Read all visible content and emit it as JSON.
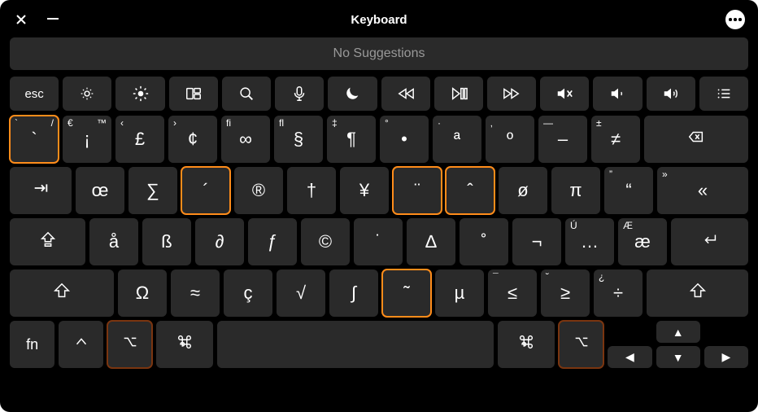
{
  "title": "Keyboard",
  "suggestions": "No Suggestions",
  "fnRow": [
    {
      "name": "esc",
      "label": "esc",
      "icon": null
    },
    {
      "name": "brightness-down",
      "icon": "bd"
    },
    {
      "name": "brightness-up",
      "icon": "bu"
    },
    {
      "name": "mission-control",
      "icon": "mc"
    },
    {
      "name": "spotlight",
      "icon": "search"
    },
    {
      "name": "dictation",
      "icon": "mic"
    },
    {
      "name": "do-not-disturb",
      "icon": "moon"
    },
    {
      "name": "rewind",
      "icon": "rw"
    },
    {
      "name": "play-pause",
      "icon": "pp"
    },
    {
      "name": "fast-forward",
      "icon": "ff"
    },
    {
      "name": "mute",
      "icon": "mute"
    },
    {
      "name": "volume-down",
      "icon": "vd"
    },
    {
      "name": "volume-up",
      "icon": "vu"
    },
    {
      "name": "list",
      "icon": "list"
    }
  ],
  "rows": [
    [
      {
        "name": "grave-key",
        "w": "w1",
        "main": "`",
        "tl": "`",
        "tr": "/",
        "cls": "orange"
      },
      {
        "name": "one-key",
        "w": "w1",
        "main": "¡",
        "tl": "€",
        "tr": "™"
      },
      {
        "name": "two-key",
        "w": "w1",
        "main": "£",
        "tl": "‹"
      },
      {
        "name": "three-key",
        "w": "w1",
        "main": "¢",
        "tl": "›"
      },
      {
        "name": "four-key",
        "w": "w1",
        "main": "∞",
        "tl": "fi"
      },
      {
        "name": "five-key",
        "w": "w1",
        "main": "§",
        "tl": "fl"
      },
      {
        "name": "six-key",
        "w": "w1",
        "main": "¶",
        "tl": "‡"
      },
      {
        "name": "seven-key",
        "w": "w1",
        "main": "•",
        "tl": "°"
      },
      {
        "name": "eight-key",
        "w": "w1",
        "main": "ª",
        "tl": "·"
      },
      {
        "name": "nine-key",
        "w": "w1",
        "main": "º",
        "tl": "‚"
      },
      {
        "name": "zero-key",
        "w": "w1",
        "main": "–",
        "tl": "—"
      },
      {
        "name": "minus-key",
        "w": "w1",
        "main": "≠",
        "tl": "±"
      },
      {
        "name": "backspace-key",
        "w": "w125",
        "icon": "bks"
      }
    ],
    [
      {
        "name": "tab-key",
        "w": "w125",
        "icon": "tab"
      },
      {
        "name": "q-key",
        "w": "w1",
        "main": "œ"
      },
      {
        "name": "w-key",
        "w": "w1",
        "main": "∑"
      },
      {
        "name": "e-key",
        "w": "w1",
        "main": "´",
        "cls": "orange"
      },
      {
        "name": "r-key",
        "w": "w1",
        "main": "®"
      },
      {
        "name": "t-key",
        "w": "w1",
        "main": "†"
      },
      {
        "name": "y-key",
        "w": "w1",
        "main": "¥"
      },
      {
        "name": "u-key",
        "w": "w1",
        "main": "¨",
        "cls": "orange"
      },
      {
        "name": "i-key",
        "w": "w1",
        "main": "ˆ",
        "cls": "orange"
      },
      {
        "name": "o-key",
        "w": "w1",
        "main": "ø"
      },
      {
        "name": "p-key",
        "w": "w1",
        "main": "π"
      },
      {
        "name": "bracket-left-key",
        "w": "w1",
        "main": "“",
        "tl": "”"
      },
      {
        "name": "bracket-right-key",
        "w": "w1",
        "main": "«",
        "tl": "»"
      }
    ],
    [
      {
        "name": "caps-lock-key",
        "w": "w15",
        "icon": "caps"
      },
      {
        "name": "a-key",
        "w": "w1",
        "main": "å"
      },
      {
        "name": "s-key",
        "w": "w1",
        "main": "ß"
      },
      {
        "name": "d-key",
        "w": "w1",
        "main": "∂"
      },
      {
        "name": "f-key",
        "w": "w1",
        "main": "ƒ"
      },
      {
        "name": "g-key",
        "w": "w1",
        "main": "©"
      },
      {
        "name": "h-key",
        "w": "w1",
        "main": "˙"
      },
      {
        "name": "j-key",
        "w": "w1",
        "main": "∆"
      },
      {
        "name": "k-key",
        "w": "w1",
        "main": "˚"
      },
      {
        "name": "l-key",
        "w": "w1",
        "main": "¬"
      },
      {
        "name": "semicolon-key",
        "w": "w1",
        "main": "…",
        "tl": "Ú"
      },
      {
        "name": "quote-key",
        "w": "w1",
        "main": "æ",
        "tl": "Æ"
      },
      {
        "name": "return-key",
        "w": "w15",
        "icon": "ret"
      }
    ],
    [
      {
        "name": "shift-left-key",
        "w": "w2",
        "icon": "shift"
      },
      {
        "name": "z-key",
        "w": "w1",
        "main": "Ω"
      },
      {
        "name": "x-key",
        "w": "w1",
        "main": "≈"
      },
      {
        "name": "c-key",
        "w": "w1",
        "main": "ç"
      },
      {
        "name": "v-key",
        "w": "w1",
        "main": "√"
      },
      {
        "name": "b-key",
        "w": "w1",
        "main": "∫"
      },
      {
        "name": "n-key",
        "w": "w1",
        "main": "˜",
        "cls": "orange"
      },
      {
        "name": "m-key",
        "w": "w1",
        "main": "µ"
      },
      {
        "name": "comma-key",
        "w": "w1",
        "main": "≤",
        "tl": "¯"
      },
      {
        "name": "period-key",
        "w": "w1",
        "main": "≥",
        "tl": "˘"
      },
      {
        "name": "slash-key",
        "w": "w1",
        "main": "÷",
        "tl": "¿"
      },
      {
        "name": "shift-right-key",
        "w": "w2",
        "icon": "shift"
      }
    ]
  ],
  "bottomRow": {
    "fn": "fn",
    "ctrl_icon": "ctrl",
    "opt_icon": "opt",
    "cmd_icon": "cmd"
  },
  "arrows": {
    "up": "▲",
    "down": "▼",
    "left": "◀",
    "right": "▶"
  }
}
